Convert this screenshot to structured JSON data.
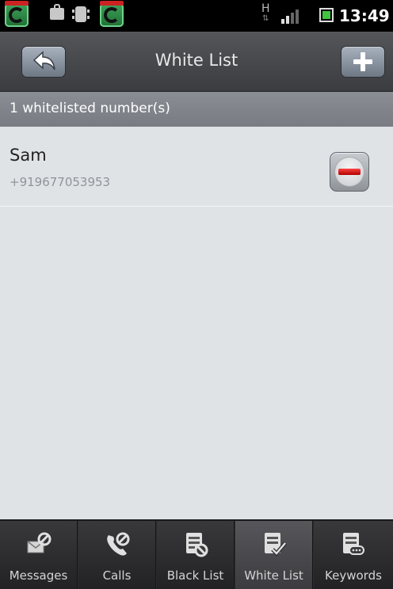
{
  "status_bar": {
    "signal_letter": "H",
    "time": "13:49",
    "notification_icons": [
      "comodo-app-icon",
      "shopping-bag-icon",
      "chip-icon",
      "comodo-app-icon"
    ]
  },
  "app_bar": {
    "title": "White List",
    "back_icon": "back-arrow-icon",
    "add_icon": "plus-icon"
  },
  "list_header": {
    "count_text": "1 whitelisted number(s)"
  },
  "entries": [
    {
      "name": "Sam",
      "number": "+919677053953",
      "action_icon": "remove-icon"
    }
  ],
  "tabs": [
    {
      "label": "Messages",
      "icon": "message-block-icon",
      "selected": false
    },
    {
      "label": "Calls",
      "icon": "phone-block-icon",
      "selected": false
    },
    {
      "label": "Black List",
      "icon": "list-block-icon",
      "selected": false
    },
    {
      "label": "White List",
      "icon": "list-check-icon",
      "selected": true
    },
    {
      "label": "Keywords",
      "icon": "keywords-icon",
      "selected": false
    }
  ],
  "colors": {
    "accent_red": "#cc0000",
    "header_bar": "#45474b",
    "list_background": "#dfe3e6"
  }
}
